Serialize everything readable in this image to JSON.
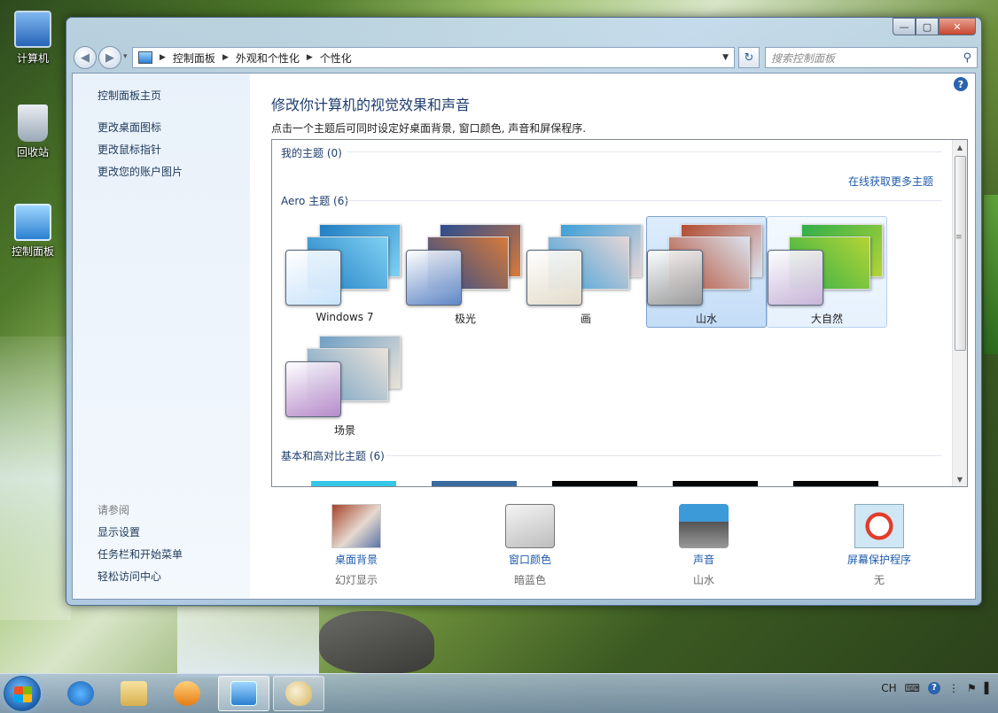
{
  "desktop": {
    "icons": [
      {
        "label": "计算机",
        "icon": "computer-icon"
      },
      {
        "label": "回收站",
        "icon": "recycle-bin-icon"
      },
      {
        "label": "控制面板",
        "icon": "control-panel-icon"
      }
    ]
  },
  "window": {
    "caption": {
      "minimize": "—",
      "maximize": "▢",
      "close": "✕"
    },
    "nav": {
      "back": "◀",
      "forward": "▶",
      "history": "▾"
    },
    "address": {
      "root_icon": "control-panel-icon",
      "crumbs": [
        "控制面板",
        "外观和个性化",
        "个性化"
      ],
      "dropdown": "▼"
    },
    "refresh": "↻",
    "search": {
      "placeholder": "搜索控制面板",
      "icon": "search-icon"
    },
    "sidebar": {
      "home": "控制面板主页",
      "links": [
        "更改桌面图标",
        "更改鼠标指针",
        "更改您的账户图片"
      ],
      "see_also_title": "请参阅",
      "see_also": [
        "显示设置",
        "任务栏和开始菜单",
        "轻松访问中心"
      ]
    },
    "main": {
      "title": "修改你计算机的视觉效果和声音",
      "subtitle": "点击一个主题后可同时设定好桌面背景, 窗口颜色, 声音和屏保程序.",
      "help": "?",
      "groups": {
        "my_themes": "我的主题 (0)",
        "online_link": "在线获取更多主题",
        "aero": "Aero 主题 (6)",
        "basic": "基本和高对比主题 (6)"
      },
      "themes": [
        {
          "name": "Windows 7",
          "state": "normal",
          "glass": "#c9e3fb",
          "bg1": "#1f7dc2",
          "bg2": "#7fd0f2"
        },
        {
          "name": "极光",
          "state": "normal",
          "glass": "#5f86c6",
          "bg1": "#2a4c8f",
          "bg2": "#d87a3a"
        },
        {
          "name": "画",
          "state": "normal",
          "glass": "#e3dccb",
          "bg1": "#3b9fd9",
          "bg2": "#e5d5d5"
        },
        {
          "name": "山水",
          "state": "selected",
          "glass": "#9a9a9a",
          "bg1": "#b24a2f",
          "bg2": "#dbe2ee"
        },
        {
          "name": "大自然",
          "state": "hover",
          "glass": "#c8b4d8",
          "bg1": "#2fae4a",
          "bg2": "#b4d436"
        },
        {
          "name": "场景",
          "state": "normal",
          "glass": "#b58ac9",
          "bg1": "#6f9fc4",
          "bg2": "#e9e2d8"
        }
      ],
      "basic_strips": [
        "#35c6e8",
        "#3a6b9e",
        "#050505",
        "#050505",
        "#050505"
      ],
      "settings": [
        {
          "label": "桌面背景",
          "value": "幻灯显示",
          "icon": "desktop-background-icon"
        },
        {
          "label": "窗口颜色",
          "value": "暗蓝色",
          "icon": "window-color-icon"
        },
        {
          "label": "声音",
          "value": "山水",
          "icon": "sound-icon"
        },
        {
          "label": "屏幕保护程序",
          "value": "无",
          "icon": "screensaver-icon"
        }
      ],
      "scroll": {
        "up": "▲",
        "down": "▼",
        "grip": "≡"
      }
    }
  },
  "taskbar": {
    "buttons": [
      {
        "name": "internet-explorer-icon",
        "state": "pinned"
      },
      {
        "name": "file-explorer-icon",
        "state": "pinned"
      },
      {
        "name": "media-player-icon",
        "state": "pinned"
      },
      {
        "name": "control-panel-icon",
        "state": "active"
      },
      {
        "name": "paint-icon",
        "state": "running"
      }
    ],
    "tray": {
      "language": "CH",
      "keyboard": "⌨",
      "help": "?",
      "pen": "⋮",
      "flag": "⚑",
      "clock_partial": "▌"
    }
  }
}
